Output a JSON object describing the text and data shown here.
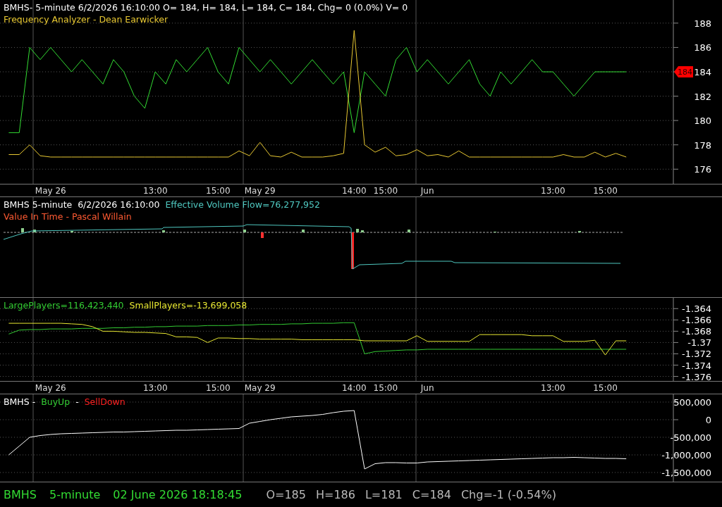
{
  "panels": [
    {
      "header_lines": [
        [
          {
            "text": "BMHS- 5-minute 6/2/2026 16:10:00 O= 184, H= 184, L= 184, C= 184, Chg= 0 (0.0%) V= 0",
            "color": "#ffffff"
          }
        ],
        [
          {
            "text": "Frequency Analyzer - Dean Earwicker",
            "color": "#e8c832"
          }
        ]
      ],
      "last_price_tag": "184",
      "chart_data": {
        "type": "line",
        "grid": true,
        "categories": [
          null,
          null,
          null,
          null,
          "May 26",
          null,
          null,
          null,
          null,
          null,
          null,
          null,
          null,
          null,
          "13:00",
          null,
          null,
          null,
          null,
          null,
          "15:00",
          null,
          null,
          null,
          "May 29",
          null,
          null,
          null,
          null,
          null,
          null,
          null,
          null,
          "14:00",
          null,
          null,
          "15:00",
          null,
          null,
          null,
          "Jun",
          null,
          null,
          null,
          null,
          null,
          null,
          null,
          null,
          null,
          null,
          null,
          "13:00",
          null,
          null,
          null,
          null,
          "15:00",
          null,
          null,
          null,
          null,
          null,
          null
        ],
        "ylim": [
          174.8,
          189.9
        ],
        "yticks": [
          176,
          178,
          180,
          182,
          184,
          186,
          188
        ],
        "series": [
          {
            "color": "#33dd33",
            "values": [
              179,
              179,
              186,
              185,
              186,
              185,
              184,
              185,
              184,
              183,
              185,
              184,
              182,
              181,
              184,
              183,
              185,
              184,
              185,
              186,
              184,
              183,
              186,
              185,
              184,
              185,
              184,
              183,
              184,
              185,
              184,
              183,
              184,
              179,
              184,
              183,
              182,
              185,
              186,
              184,
              185,
              184,
              183,
              184,
              185,
              183,
              182,
              184,
              183,
              184,
              185,
              184,
              184,
              183,
              182,
              183,
              184,
              184,
              184,
              184,
              null,
              null,
              null,
              null
            ]
          },
          {
            "color": "#e8c832",
            "values": [
              177.2,
              177.2,
              178,
              177.1,
              177,
              177,
              177,
              177,
              177,
              177,
              177,
              177,
              177,
              177,
              177,
              177,
              177,
              177,
              177,
              177,
              177,
              177,
              177.5,
              177.1,
              178.2,
              177.1,
              177,
              177.4,
              177,
              177,
              177,
              177.1,
              177.3,
              187.4,
              178,
              177.4,
              177.8,
              177.1,
              177.2,
              177.6,
              177.1,
              177.2,
              177,
              177.5,
              177,
              177,
              177,
              177,
              177,
              177,
              177,
              177,
              177,
              177.2,
              177,
              177,
              177.4,
              177,
              177.3,
              177,
              null,
              null,
              null,
              null
            ]
          }
        ]
      }
    },
    {
      "header_lines": [
        [
          {
            "text": "BMHS 5-minute  6/2/2026 16:10:00",
            "color": "#ffffff"
          },
          {
            "text": "Effective Volume Flow=76,277,952",
            "color": "#4fc8c0"
          }
        ],
        [
          {
            "text": "Value In Time - Pascal Willain",
            "color": "#ff5a32"
          }
        ]
      ],
      "plot": {
        "kind": "picture"
      }
    },
    {
      "header_lines": [
        [
          {
            "text": "LargePlayers=116,423,440",
            "color": "#33cc33"
          },
          {
            "text": "SmallPlayers=-13,699,058",
            "color": "#e8e832"
          }
        ]
      ],
      "chart_data": {
        "type": "line",
        "grid": true,
        "categories": [
          null,
          null,
          null,
          null,
          "May 26",
          null,
          null,
          null,
          null,
          null,
          null,
          null,
          null,
          null,
          "13:00",
          null,
          null,
          null,
          null,
          null,
          "15:00",
          null,
          null,
          null,
          "May 29",
          null,
          null,
          null,
          null,
          null,
          null,
          null,
          null,
          "14:00",
          null,
          null,
          "15:00",
          null,
          null,
          null,
          "Jun",
          null,
          null,
          null,
          null,
          null,
          null,
          null,
          null,
          null,
          null,
          null,
          "13:00",
          null,
          null,
          null,
          null,
          "15:00",
          null,
          null,
          null,
          null,
          null,
          null
        ],
        "ylim": [
          -1.3768,
          -1.3621
        ],
        "yticks": [
          -1.376,
          -1.374,
          -1.372,
          -1.37,
          -1.368,
          -1.366,
          -1.364
        ],
        "series": [
          {
            "color": "#33cc33",
            "values": [
              -1.3685,
              -1.3678,
              -1.3677,
              -1.3677,
              -1.3676,
              -1.3676,
              -1.3676,
              -1.3675,
              -1.3675,
              -1.3675,
              -1.3674,
              -1.3674,
              -1.3673,
              -1.3673,
              -1.3672,
              -1.3672,
              -1.3671,
              -1.3671,
              -1.3671,
              -1.367,
              -1.367,
              -1.367,
              -1.3669,
              -1.3669,
              -1.3668,
              -1.3668,
              -1.3668,
              -1.3667,
              -1.3667,
              -1.3666,
              -1.3666,
              -1.3666,
              -1.3665,
              -1.3665,
              -1.372,
              -1.3716,
              -1.3715,
              -1.3714,
              -1.3713,
              -1.3713,
              -1.3712,
              -1.3712,
              -1.3712,
              -1.3712,
              -1.3712,
              -1.3712,
              -1.3712,
              -1.3712,
              -1.3712,
              -1.3712,
              -1.3712,
              -1.3712,
              -1.3712,
              -1.3712,
              -1.3712,
              -1.3712,
              -1.3712,
              -1.3712,
              -1.3712,
              -1.3712,
              null,
              null,
              null,
              null
            ]
          },
          {
            "color": "#e8e832",
            "values": [
              -1.3666,
              -1.3666,
              -1.3666,
              -1.3666,
              -1.3666,
              -1.3666,
              -1.3667,
              -1.3668,
              -1.3672,
              -1.368,
              -1.368,
              -1.3681,
              -1.3682,
              -1.3682,
              -1.3683,
              -1.3684,
              -1.369,
              -1.369,
              -1.3691,
              -1.37,
              -1.3692,
              -1.3692,
              -1.3693,
              -1.3693,
              -1.3694,
              -1.3694,
              -1.3694,
              -1.3694,
              -1.3695,
              -1.3695,
              -1.3695,
              -1.3695,
              -1.3695,
              -1.3695,
              -1.3697,
              -1.3697,
              -1.3697,
              -1.3697,
              -1.3697,
              -1.3688,
              -1.3698,
              -1.3698,
              -1.3698,
              -1.3698,
              -1.3698,
              -1.3686,
              -1.3686,
              -1.3686,
              -1.3686,
              -1.3686,
              -1.3688,
              -1.3688,
              -1.3688,
              -1.3698,
              -1.3698,
              -1.3698,
              -1.3696,
              -1.3722,
              -1.3697,
              -1.3697,
              null,
              null,
              null,
              null
            ]
          }
        ]
      }
    },
    {
      "header_lines": [
        [
          {
            "text": "BMHS -",
            "color": "#ffffff"
          },
          {
            "text": "BuyUp",
            "color": "#33cc33"
          },
          {
            "text": "-",
            "color": "#ffffff"
          },
          {
            "text": "SellDown",
            "color": "#ff2020"
          }
        ]
      ],
      "chart_data": {
        "type": "line",
        "grid": true,
        "categories": [
          null,
          null,
          null,
          null,
          null,
          null,
          null,
          null,
          null,
          null,
          null,
          null,
          null,
          null,
          null,
          null,
          null,
          null,
          null,
          null,
          null,
          null,
          null,
          null,
          null,
          null,
          null,
          null,
          null,
          null,
          null,
          null,
          null,
          null,
          null,
          null,
          null,
          null,
          null,
          null,
          null,
          null,
          null,
          null,
          null,
          null,
          null,
          null,
          null,
          null,
          null,
          null,
          null,
          null,
          null,
          null,
          null,
          null,
          null,
          null,
          null,
          null,
          null,
          null
        ],
        "ylim": [
          -1760000,
          720000
        ],
        "yticks": [
          {
            "value": -1500000,
            "label": "-1,500,000"
          },
          {
            "value": -1000000,
            "label": "-1,000,000"
          },
          {
            "value": -500000,
            "label": "-500,000"
          },
          {
            "value": 0,
            "label": "0"
          },
          {
            "value": 500000,
            "label": "500,000"
          }
        ],
        "series": [
          {
            "color": "#ffffff",
            "values": [
              -1000000,
              -750000,
              -500000,
              -450000,
              -420000,
              -400000,
              -390000,
              -380000,
              -370000,
              -360000,
              -350000,
              -350000,
              -340000,
              -330000,
              -320000,
              -310000,
              -300000,
              -300000,
              -290000,
              -280000,
              -270000,
              -260000,
              -250000,
              -100000,
              -50000,
              0,
              40000,
              80000,
              100000,
              120000,
              150000,
              200000,
              240000,
              260000,
              -1400000,
              -1250000,
              -1220000,
              -1220000,
              -1230000,
              -1230000,
              -1200000,
              -1190000,
              -1180000,
              -1170000,
              -1160000,
              -1150000,
              -1140000,
              -1130000,
              -1120000,
              -1110000,
              -1100000,
              -1090000,
              -1080000,
              -1080000,
              -1070000,
              -1080000,
              -1090000,
              -1100000,
              -1100000,
              -1110000,
              null,
              null,
              null,
              null
            ]
          }
        ]
      }
    }
  ],
  "status_bar": {
    "left": [
      {
        "text": "BMHS"
      },
      {
        "text": "5-minute"
      },
      {
        "text": "02 June 2026 18:18:45"
      }
    ],
    "right": [
      {
        "text": "O=185"
      },
      {
        "text": "H=186"
      },
      {
        "text": "L=181"
      },
      {
        "text": "C=184"
      },
      {
        "text": "Chg=-1 (-0.54%)"
      }
    ]
  }
}
